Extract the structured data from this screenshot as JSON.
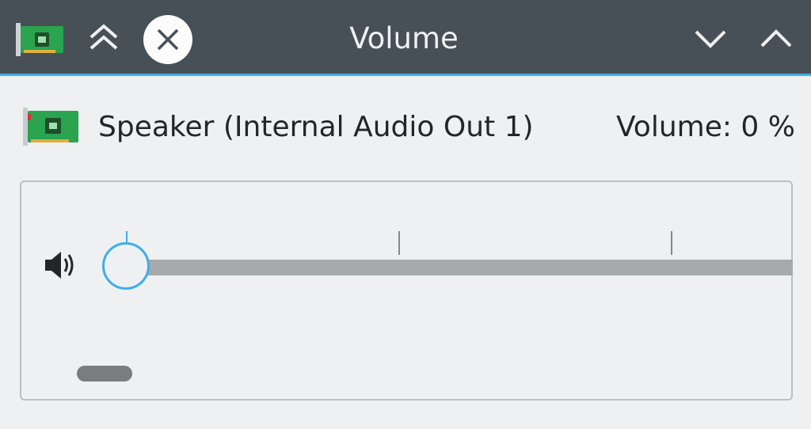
{
  "window": {
    "title": "Volume",
    "icons": {
      "app": "sound-card-icon",
      "keep_above": "double-chevron-up-icon",
      "close": "close-icon",
      "minimize": "chevron-down-icon",
      "maximize": "chevron-up-icon"
    }
  },
  "device": {
    "name": "Speaker (Internal Audio Out 1)",
    "volume_label": "Volume: 0 %",
    "volume_percent": 0,
    "icon": "sound-card-icon"
  },
  "slider": {
    "icon": "speaker-icon",
    "value_percent": 0,
    "tick_count": 3
  },
  "colors": {
    "titlebar_bg": "#475057",
    "accent": "#3daee9",
    "window_bg": "#eff0f1",
    "text": "#232627"
  }
}
